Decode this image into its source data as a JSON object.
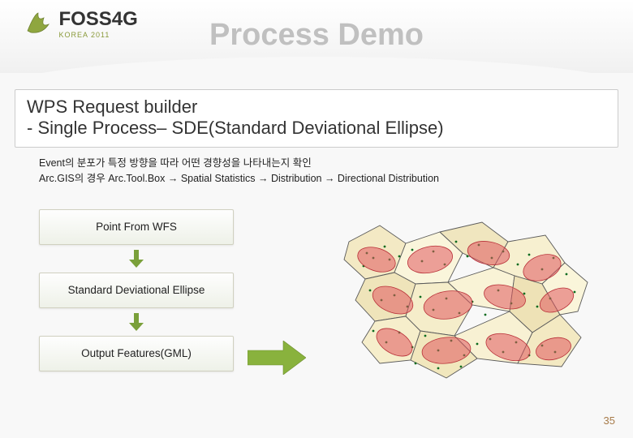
{
  "logo": {
    "text": "FOSS4G",
    "sub": "KOREA 2011"
  },
  "slide_title": "Process Demo",
  "title_box": {
    "line1": "WPS Request builder",
    "line2": " - Single Process– SDE(Standard Deviational Ellipse)"
  },
  "desc": {
    "line1": "Event의 분포가 특정 방향을 따라 어떤 경향성을 나타내는지 확인",
    "line2": "Arc.GIS의 경우 Arc.Tool.Box → Spatial Statistics → Distribution  → Directional Distribution"
  },
  "flow": {
    "box1": "Point From WFS",
    "box2": "Standard Deviational Ellipse",
    "box3": "Output Features(GML)"
  },
  "colors": {
    "arrow_down": "#7aa03a",
    "big_arrow": "#89b23d"
  },
  "page_number": "35"
}
